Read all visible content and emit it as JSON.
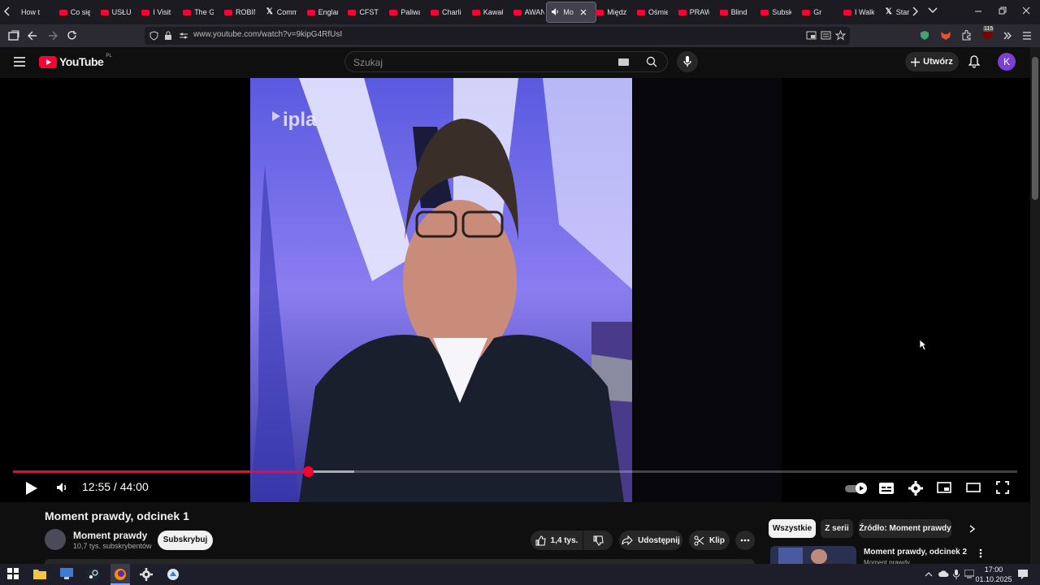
{
  "browser": {
    "tabs": [
      {
        "label": "How t",
        "icon": "tab-page-icon"
      },
      {
        "label": "Co się",
        "icon": "youtube-icon"
      },
      {
        "label": "USŁUG",
        "icon": "youtube-icon"
      },
      {
        "label": "I Visit",
        "icon": "youtube-icon"
      },
      {
        "label": "The G",
        "icon": "youtube-icon"
      },
      {
        "label": "ROBIN",
        "icon": "youtube-icon"
      },
      {
        "label": "Comm",
        "icon": "x-icon"
      },
      {
        "label": "Englan",
        "icon": "youtube-icon"
      },
      {
        "label": "CFSTV",
        "icon": "youtube-icon"
      },
      {
        "label": "Paliwa",
        "icon": "youtube-icon"
      },
      {
        "label": "Charlie",
        "icon": "youtube-icon"
      },
      {
        "label": "Kawał",
        "icon": "youtube-icon"
      },
      {
        "label": "AWAN",
        "icon": "youtube-icon"
      },
      {
        "label": "Mo",
        "icon": "speaker-icon",
        "active": true
      },
      {
        "label": "Międz",
        "icon": "youtube-icon"
      },
      {
        "label": "Ośmie",
        "icon": "youtube-icon"
      },
      {
        "label": "PRAW",
        "icon": "youtube-icon"
      },
      {
        "label": "Blind",
        "icon": "youtube-icon"
      },
      {
        "label": "Subsk",
        "icon": "youtube-icon"
      },
      {
        "label": "Gr",
        "icon": "youtube-icon"
      },
      {
        "label": "I Walk",
        "icon": "youtube-icon"
      },
      {
        "label": "Star",
        "icon": "x-icon"
      }
    ],
    "url": "www.youtube.com/watch?v=9kipG4RfUsI",
    "extension_badge": "115"
  },
  "youtube": {
    "logo_text": "YouTube",
    "region": "PL",
    "search_placeholder": "Szukaj",
    "create_label": "Utwórz",
    "avatar_letter": "K"
  },
  "player": {
    "channel_watermark": "ipla",
    "current_time": "12:55",
    "duration": "44:00",
    "time_display": "12:55 / 44:00",
    "progress_fraction": 0.2936,
    "buffered_fraction": 0.34
  },
  "video": {
    "title": "Moment prawdy, odcinek 1",
    "channel_name": "Moment prawdy",
    "subscribers": "10,7 tys. subskrybentów",
    "subscribe_label": "Subskrybuj",
    "likes": "1,4 tys.",
    "share_label": "Udostępnij",
    "clip_label": "Klip"
  },
  "sidebar": {
    "chips": [
      {
        "label": "Wszystkie",
        "active": true
      },
      {
        "label": "Z serii",
        "active": false
      },
      {
        "label": "Źródło: Moment prawdy",
        "active": false
      }
    ],
    "next_video": {
      "title": "Moment prawdy, odcinek 2",
      "channel": "Moment prawdy"
    }
  },
  "taskbar": {
    "time": "17:00",
    "date": "01.10.2025"
  },
  "colors": {
    "accent": "#ff0033",
    "background": "#0f0f0f",
    "avatar": "#7b3fd4"
  }
}
